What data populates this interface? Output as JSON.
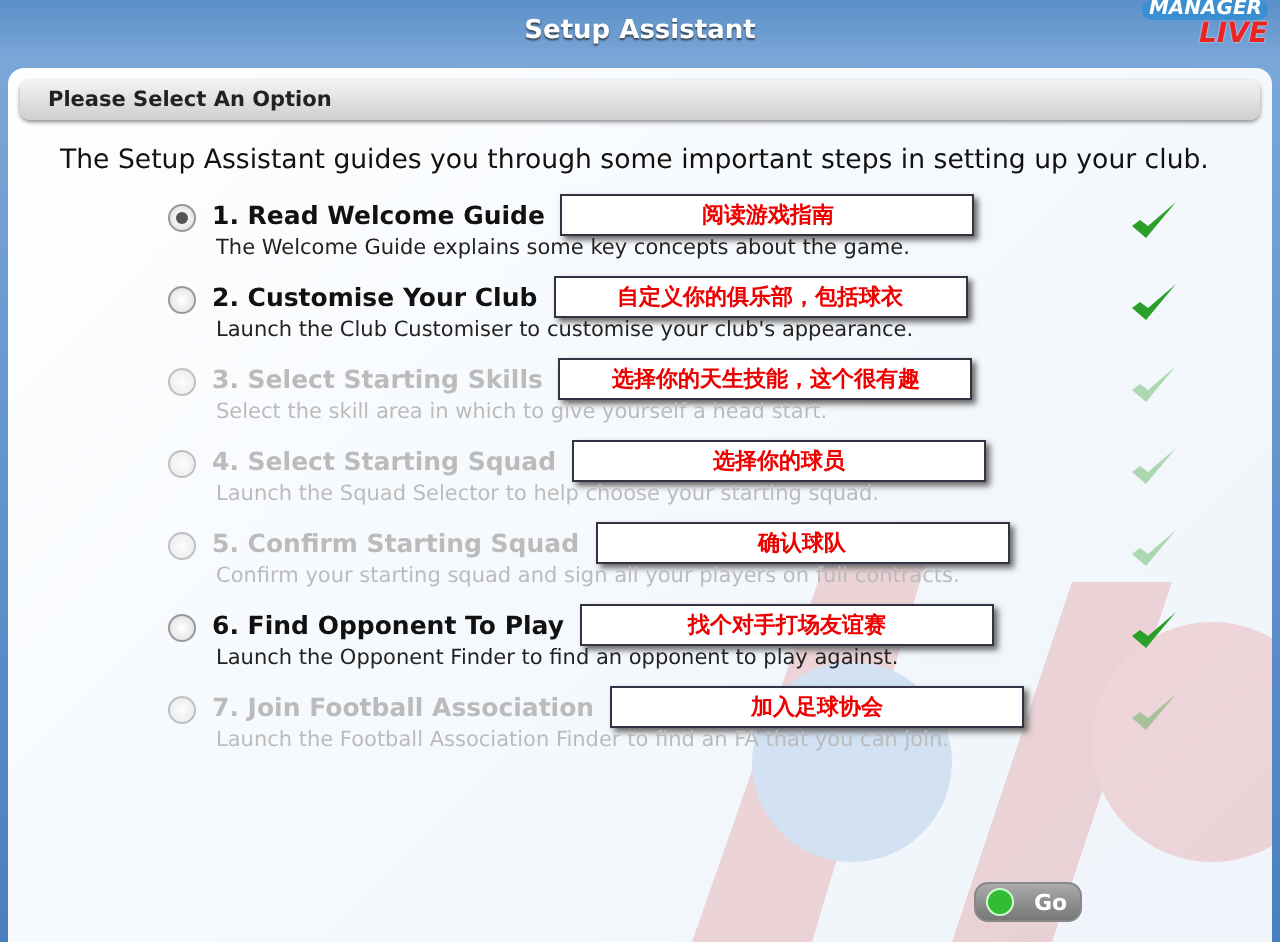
{
  "window": {
    "title": "Setup Assistant"
  },
  "logo": {
    "line1": "MANAGER",
    "line2": "LIVE"
  },
  "panel": {
    "header": "Please Select An Option",
    "intro": "The Setup Assistant guides you through some important steps in setting up your club."
  },
  "options": [
    {
      "title": "1. Read Welcome Guide",
      "description": "The Welcome Guide explains some key concepts about the game.",
      "selected": true,
      "disabled": false,
      "annotation": "阅读游戏指南"
    },
    {
      "title": "2. Customise Your Club",
      "description": "Launch the Club Customiser to customise your club's appearance.",
      "selected": false,
      "disabled": false,
      "annotation": "自定义你的俱乐部，包括球衣"
    },
    {
      "title": "3. Select Starting Skills",
      "description": "Select the skill area in which to give yourself a head start.",
      "selected": false,
      "disabled": true,
      "annotation": "选择你的天生技能，这个很有趣"
    },
    {
      "title": "4. Select Starting Squad",
      "description": "Launch the Squad Selector to help choose your starting squad.",
      "selected": false,
      "disabled": true,
      "annotation": "选择你的球员"
    },
    {
      "title": "5. Confirm Starting Squad",
      "description": "Confirm your starting squad and sign all your players on full contracts.",
      "selected": false,
      "disabled": true,
      "annotation": "确认球队"
    },
    {
      "title": "6. Find Opponent To Play",
      "description": "Launch the Opponent Finder to find an opponent to play against.",
      "selected": false,
      "disabled": false,
      "annotation": "找个对手打场友谊赛"
    },
    {
      "title": "7. Join Football Association",
      "description": "Launch the Football Association Finder to find an FA that you can join.",
      "selected": false,
      "disabled": true,
      "annotation": "加入足球协会"
    }
  ],
  "go_button": {
    "label": "Go"
  }
}
